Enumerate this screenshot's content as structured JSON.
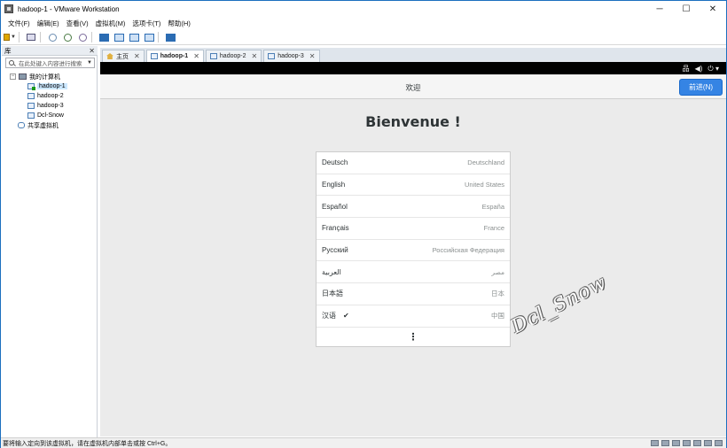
{
  "window": {
    "title": "hadoop-1 - VMware Workstation",
    "minimize": "─",
    "maximize": "☐",
    "close": "✕"
  },
  "menu": [
    "文件(F)",
    "编辑(E)",
    "查看(V)",
    "虚拟机(M)",
    "选项卡(T)",
    "帮助(H)"
  ],
  "library": {
    "title": "库",
    "close": "✕",
    "search_placeholder": "在此处键入内容进行搜索",
    "tree": {
      "root": "我的计算机",
      "root_expander": "−",
      "vms": [
        "hadoop-1",
        "hadoop-2",
        "hadoop-3",
        "Dcl-Snow"
      ],
      "shared": "共享虚拟机"
    }
  },
  "tabs": [
    {
      "label": "主页",
      "icon": "home-icon"
    },
    {
      "label": "hadoop-1",
      "icon": "vm-icon"
    },
    {
      "label": "hadoop-2",
      "icon": "vm-icon"
    },
    {
      "label": "hadoop-3",
      "icon": "vm-icon"
    }
  ],
  "tab_close": "✕",
  "guest": {
    "header_title": "欢迎",
    "next_button": "前进(N)",
    "welcome": "Bienvenue !",
    "languages": [
      {
        "name": "Deutsch",
        "region": "Deutschland"
      },
      {
        "name": "English",
        "region": "United States"
      },
      {
        "name": "Español",
        "region": "España"
      },
      {
        "name": "Français",
        "region": "France"
      },
      {
        "name": "Русский",
        "region": "Российская Федерация"
      },
      {
        "name": "العربية",
        "region": "مصر"
      },
      {
        "name": "日本語",
        "region": "日本"
      },
      {
        "name": "汉语",
        "region": "中国",
        "selected": true
      }
    ],
    "more": "⋮",
    "check": "✔",
    "status_icons": [
      "network-icon",
      "volume-icon",
      "power-icon"
    ],
    "status_glyphs": [
      "品",
      "◀)",
      "⏻ ▾"
    ]
  },
  "watermark": "Dcl_Snow",
  "statusbar": {
    "text": "要将输入定向到该虚拟机，请在虚拟机内部单击或按 Ctrl+G。"
  },
  "colors": {
    "accent": "#3584e4",
    "window_border": "#1c6fbf",
    "selection": "#cce8ff"
  }
}
